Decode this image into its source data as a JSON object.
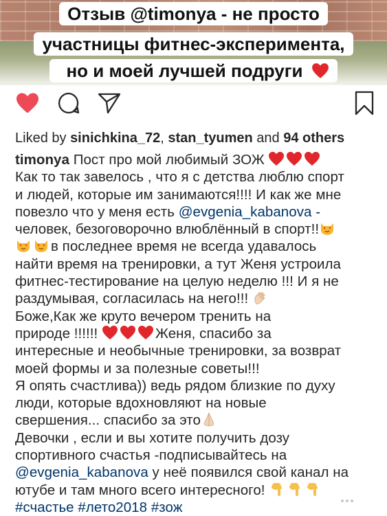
{
  "banner": {
    "line1": "Отзыв @timonya - не просто",
    "line2": "участницы фитнес-эксперимента,",
    "line3": "но и моей лучшей подруги"
  },
  "actions": {
    "like": "heart-filled-icon",
    "comment": "comment-icon",
    "share": "send-icon",
    "save": "bookmark-icon",
    "like_color": "#ed4956"
  },
  "likes": {
    "prefix": "Liked by ",
    "user1": "sinichkina_72",
    "sep": ", ",
    "user2": "stan_tyumen",
    "and": " and ",
    "others": "94 others"
  },
  "post": {
    "username": "timonya",
    "l1": " Пост про мой любимый ЗОЖ ",
    "l2": "Как то так завелось , что я с детства люблю спорт",
    "l3": "и людей, которые им занимаются!!!! И как же мне",
    "l4a": "повезло что у меня есть ",
    "mention1": "@evgenia_kabanova",
    "l4b": " -",
    "l5": "человек, безоговорочно влюблённый в спорт!!",
    "l6": "в последнее время не всегда удавалось",
    "l7": "найти время на тренировки, а тут Женя  устроила",
    "l8": "фитнес-тестирование на целую неделю !!! И я не",
    "l9": "раздумывая, согласилась на него!!! ",
    "l10": "Боже,Как же круто вечером тренить на",
    "l11a": "природе !!!!!! ",
    "l11b": "Женя, спасибо за",
    "l12": "интересные и необычные тренировки, за возврат",
    "l13": "моей формы и за полезные советы!!!",
    "l14": "Я опять счастлива)) ведь рядом близкие по духу",
    "l15": "люди, которые вдохновляют на новые",
    "l16": "свершения... спасибо за это",
    "l17": "Девочки , если и вы хотите получить дозу",
    "l18": "спортивного счастья -подписывайтесь на",
    "mention2": "@evgenia_kabanova",
    "l19b": " у неё появился свой канал на",
    "l20": "ютубе и там много всего интересного! ",
    "tags": [
      "#счастье",
      "#лето2018",
      "#зож"
    ]
  }
}
